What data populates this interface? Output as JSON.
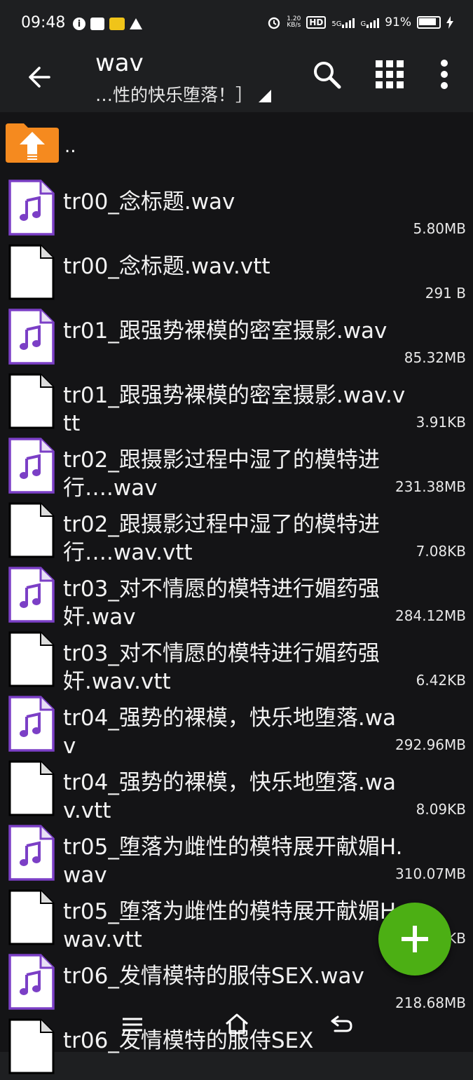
{
  "status_bar": {
    "time": "09:48",
    "speed_value": "1.20",
    "speed_unit": "KB/s",
    "hd": "HD",
    "network": "5G",
    "signal2": "G",
    "battery": "91%"
  },
  "app_bar": {
    "title": "wav",
    "subtitle": "…性的快乐堕落！］"
  },
  "parent_label": "..",
  "files": [
    {
      "name": "tr00_念标题.wav",
      "size": "5.80MB",
      "type": "audio"
    },
    {
      "name": "tr00_念标题.wav.vtt",
      "size": "291 B",
      "type": "doc"
    },
    {
      "name": "tr01_跟强势裸模的密室摄影.wav",
      "size": "85.32MB",
      "type": "audio"
    },
    {
      "name": "tr01_跟强势裸模的密室摄影.wav.vtt",
      "size": "3.91KB",
      "type": "doc"
    },
    {
      "name": "tr02_跟摄影过程中湿了的模特进行….wav",
      "size": "231.38MB",
      "type": "audio"
    },
    {
      "name": "tr02_跟摄影过程中湿了的模特进行….wav.vtt",
      "size": "7.08KB",
      "type": "doc"
    },
    {
      "name": "tr03_对不情愿的模特进行媚药强奸.wav",
      "size": "284.12MB",
      "type": "audio"
    },
    {
      "name": "tr03_对不情愿的模特进行媚药强奸.wav.vtt",
      "size": "6.42KB",
      "type": "doc"
    },
    {
      "name": "tr04_强势的裸模，快乐地堕落.wav",
      "size": "292.96MB",
      "type": "audio"
    },
    {
      "name": "tr04_强势的裸模，快乐地堕落.wav.vtt",
      "size": "8.09KB",
      "type": "doc"
    },
    {
      "name": "tr05_堕落为雌性的模特展开献媚H.wav",
      "size": "310.07MB",
      "type": "audio"
    },
    {
      "name": "tr05_堕落为雌性的模特展开献媚H.wav.vtt",
      "size": "KB",
      "type": "doc"
    },
    {
      "name": "tr06_发情模特的服侍SEX.wav",
      "size": "218.68MB",
      "type": "audio"
    },
    {
      "name": "tr06_发情模特的服侍SEX",
      "size": "",
      "type": "doc"
    }
  ],
  "icons": {
    "back": "arrow-left-icon",
    "search": "search-icon",
    "grid": "grid-view-icon",
    "more": "more-vert-icon",
    "folder_up": "folder-up-icon",
    "audio": "audio-file-icon",
    "document": "document-file-icon",
    "fab": "add-icon"
  },
  "colors": {
    "background": "#1e1f21",
    "list_background": "#141416",
    "fab": "#4caf14",
    "audio_accent": "#7b3fc6",
    "folder": "#f58a1f"
  }
}
